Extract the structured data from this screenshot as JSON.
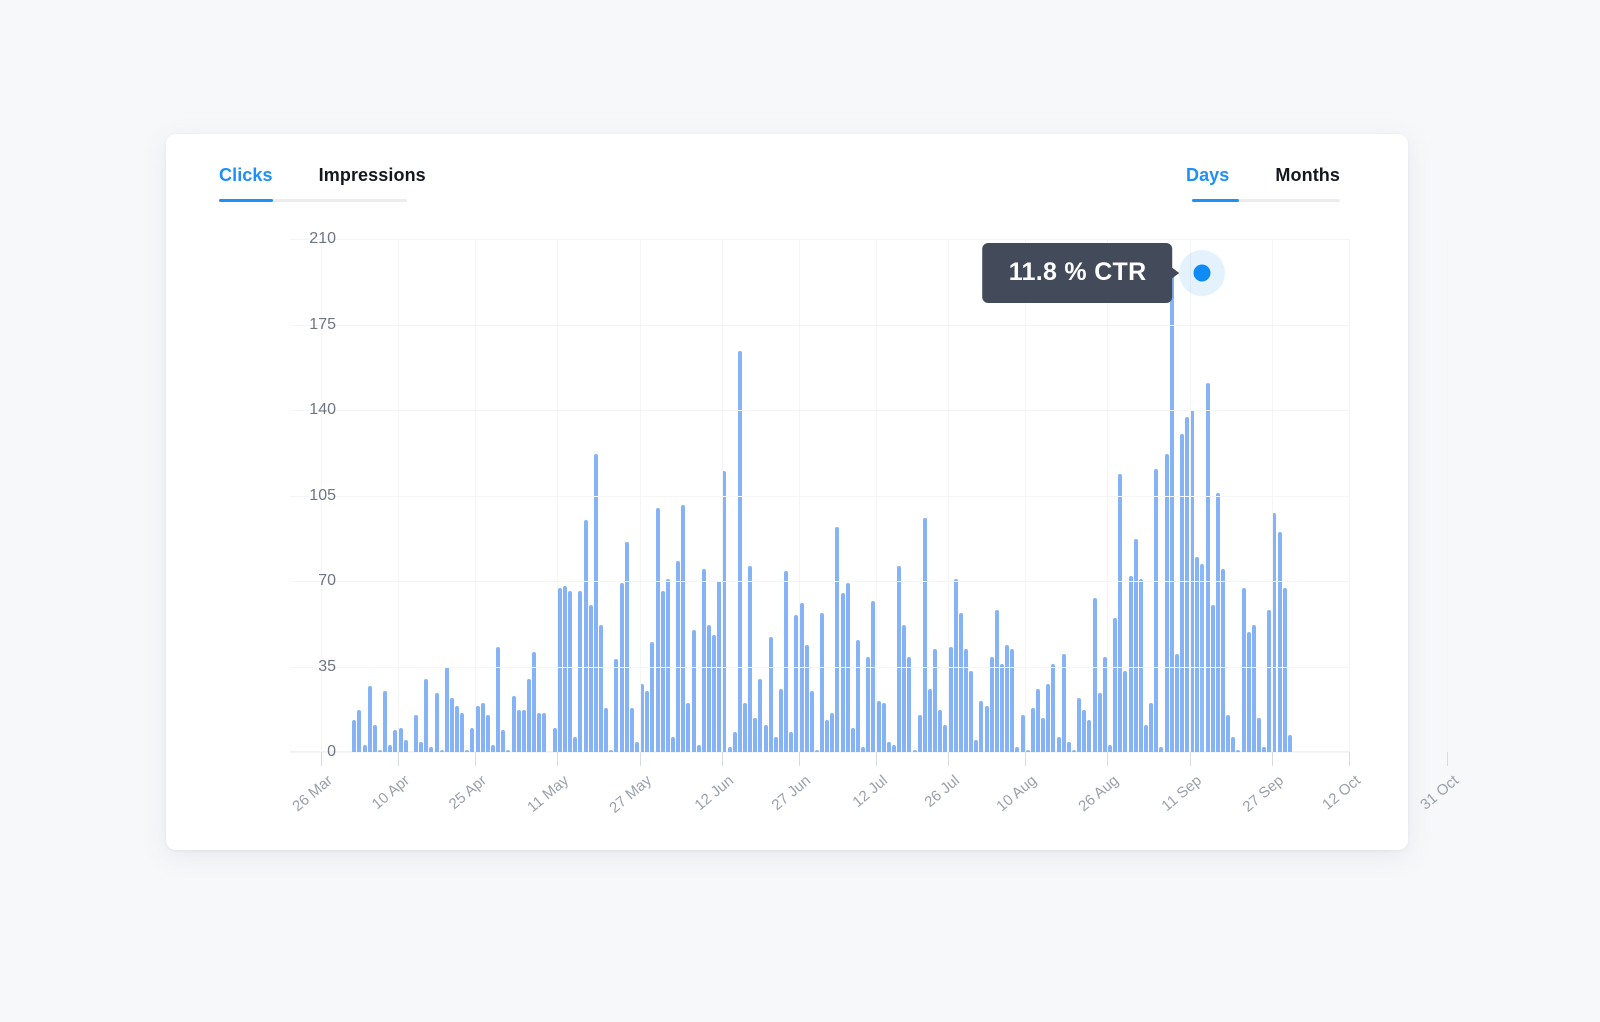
{
  "card": {
    "tabs_left": [
      {
        "label": "Clicks",
        "active": true
      },
      {
        "label": "Impressions",
        "active": false
      }
    ],
    "tabs_right": [
      {
        "label": "Days",
        "active": true
      },
      {
        "label": "Months",
        "active": false
      }
    ]
  },
  "tooltip": {
    "text": "11.8 % CTR",
    "bg_color": "#434a5a",
    "text_color": "#ffffff"
  },
  "colors": {
    "accent": "#1e90f7",
    "bar": "#85b3f5",
    "marker": "#0e8bf5",
    "axis_text": "#6f7683",
    "xlabel_text": "#9aa0ab",
    "card_bg": "#ffffff",
    "page_bg": "#f7f8fa",
    "grid": "#f4f5f7"
  },
  "chart_data": {
    "type": "bar",
    "title": "",
    "xlabel": "",
    "ylabel": "",
    "ylim": [
      0,
      210
    ],
    "yticks": [
      0,
      35,
      70,
      105,
      140,
      175,
      210
    ],
    "grid": true,
    "legend": "none",
    "highlight": {
      "index": 177,
      "value": 196,
      "label": "11.8 % CTR"
    },
    "xtick_labels": [
      "26 Mar",
      "10 Apr",
      "25 Apr",
      "11 May",
      "27 May",
      "12 Jun",
      "27 Jun",
      "12 Jul",
      "26 Jul",
      "10 Aug",
      "26 Aug",
      "11 Sep",
      "27 Sep",
      "12 Oct",
      "31 Oct"
    ],
    "xtick_indices": [
      6,
      21,
      36,
      52,
      68,
      84,
      99,
      114,
      128,
      143,
      159,
      175,
      191,
      206,
      225
    ],
    "values": [
      0,
      0,
      0,
      0,
      0,
      0,
      0,
      0,
      0,
      0,
      0,
      0,
      13,
      17,
      3,
      27,
      11,
      1,
      25,
      3,
      9,
      10,
      5,
      0,
      15,
      4,
      30,
      2,
      24,
      1,
      35,
      22,
      19,
      16,
      1,
      10,
      19,
      20,
      15,
      3,
      43,
      9,
      1,
      23,
      17,
      17,
      30,
      41,
      16,
      16,
      0,
      10,
      67,
      68,
      66,
      6,
      66,
      95,
      60,
      122,
      52,
      18,
      1,
      38,
      69,
      86,
      18,
      4,
      28,
      25,
      45,
      100,
      66,
      71,
      6,
      78,
      101,
      20,
      50,
      3,
      75,
      52,
      48,
      70,
      115,
      2,
      8,
      164,
      20,
      76,
      14,
      30,
      11,
      47,
      6,
      26,
      74,
      8,
      56,
      61,
      44,
      25,
      1,
      57,
      13,
      16,
      92,
      65,
      69,
      10,
      46,
      2,
      39,
      62,
      21,
      20,
      4,
      3,
      76,
      52,
      39,
      1,
      15,
      96,
      26,
      42,
      17,
      11,
      43,
      71,
      57,
      42,
      33,
      5,
      21,
      19,
      39,
      58,
      36,
      44,
      42,
      2,
      15,
      1,
      18,
      26,
      14,
      28,
      36,
      6,
      40,
      4,
      1,
      22,
      17,
      13,
      63,
      24,
      39,
      3,
      55,
      114,
      33,
      72,
      87,
      71,
      11,
      20,
      116,
      2,
      122,
      196,
      40,
      130,
      137,
      140,
      80,
      77,
      151,
      60,
      106,
      75,
      15,
      6,
      1,
      67,
      49,
      52,
      14,
      2,
      58,
      98,
      90,
      67,
      7,
      0,
      0,
      0,
      0,
      0,
      0,
      0,
      0,
      0,
      0,
      0
    ]
  }
}
